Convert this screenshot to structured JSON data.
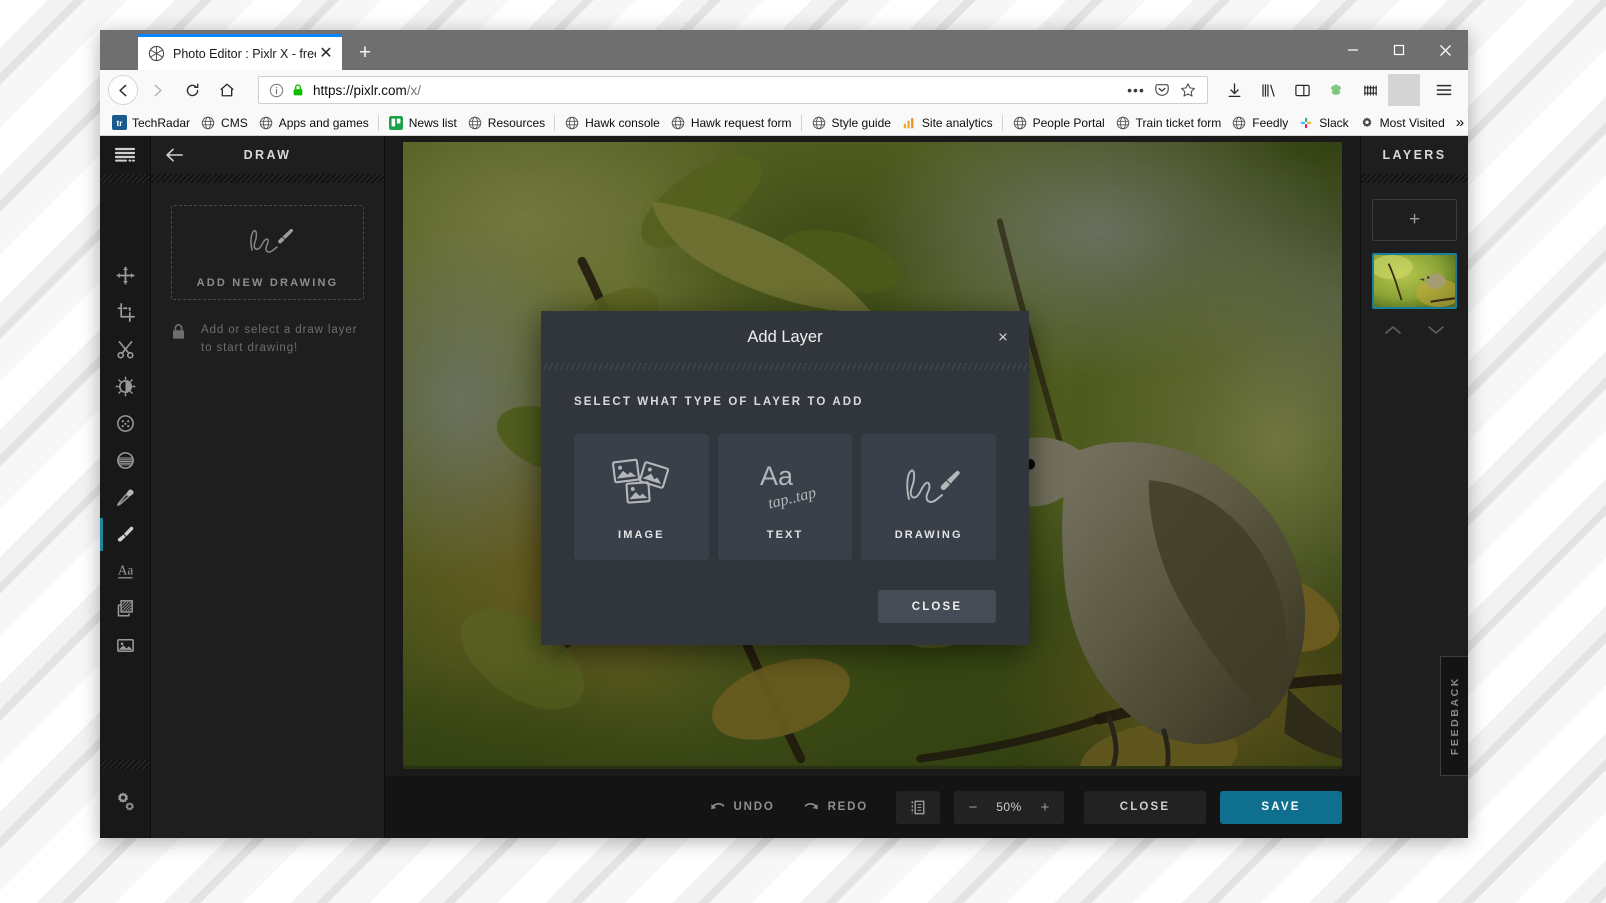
{
  "browser": {
    "tab": {
      "title": "Photo Editor : Pixlr X - free imag",
      "favicon": "pixlr-aperture-icon",
      "close_label": "✕"
    },
    "newtab_label": "+",
    "window_controls": {
      "minimize": "—",
      "maximize": "□",
      "close": "✕"
    },
    "nav": {
      "back": "←",
      "forward": "→",
      "reload": "↻",
      "home": "⌂"
    },
    "url": {
      "scheme_host": "https://pixlr.com",
      "path": "/x/",
      "info_icon": "info-icon",
      "lock_icon": "padlock-icon"
    },
    "urlbar_actions": {
      "page_actions": "•••",
      "pocket": "pocket-icon",
      "bookmark": "star-icon"
    },
    "toolbar_icons": [
      "downloads-icon",
      "library-icon",
      "sidebar-icon",
      "ublock-icon",
      "container-tabs-icon",
      "menu-icon"
    ],
    "bookmarks": [
      {
        "label": "TechRadar",
        "icon": "techradar-icon"
      },
      {
        "label": "CMS",
        "icon": "globe-icon"
      },
      {
        "label": "Apps and games",
        "icon": "globe-icon"
      },
      {
        "sep": true
      },
      {
        "label": "News list",
        "icon": "trello-icon"
      },
      {
        "label": "Resources",
        "icon": "globe-icon"
      },
      {
        "sep": true
      },
      {
        "label": "Hawk console",
        "icon": "globe-icon"
      },
      {
        "label": "Hawk request form",
        "icon": "globe-icon"
      },
      {
        "sep": true
      },
      {
        "label": "Style guide",
        "icon": "globe-icon"
      },
      {
        "label": "Site analytics",
        "icon": "analytics-icon"
      },
      {
        "sep": true
      },
      {
        "label": "People Portal",
        "icon": "globe-icon"
      },
      {
        "label": "Train ticket form",
        "icon": "globe-icon"
      },
      {
        "label": "Feedly",
        "icon": "globe-icon"
      },
      {
        "label": "Slack",
        "icon": "slack-icon"
      },
      {
        "label": "Most Visited",
        "icon": "gear-icon"
      }
    ],
    "bookmarks_overflow": "»"
  },
  "app": {
    "rail": {
      "menu_icon": "hamburger-menu-icon",
      "tools": [
        {
          "name": "arrange-tool",
          "icon": "move-arrows-icon",
          "active": false
        },
        {
          "name": "crop-tool",
          "icon": "crop-icon",
          "active": false
        },
        {
          "name": "cutout-tool",
          "icon": "scissors-icon",
          "active": false
        },
        {
          "name": "adjust-tool",
          "icon": "brightness-icon",
          "active": false
        },
        {
          "name": "effect-tool",
          "icon": "dots-circle-icon",
          "active": false
        },
        {
          "name": "retouch-tool",
          "icon": "halftone-circle-icon",
          "active": false
        },
        {
          "name": "liquify-tool",
          "icon": "dropper-icon",
          "active": false
        },
        {
          "name": "draw-tool",
          "icon": "paintbrush-icon",
          "active": true
        },
        {
          "name": "text-tool",
          "icon": "text-aa-icon",
          "active": false
        },
        {
          "name": "element-tool",
          "icon": "layers-stack-icon",
          "active": false
        },
        {
          "name": "add-image-tool",
          "icon": "picture-icon",
          "active": false
        }
      ],
      "settings_icon": "gears-icon"
    },
    "panel": {
      "back_icon": "arrow-left-icon",
      "title": "DRAW",
      "dropzone": {
        "icon": "drawing-squiggle-brush-icon",
        "label": "ADD NEW DRAWING"
      },
      "hint": {
        "icon": "padlock-icon",
        "text": "Add or select a draw layer to start drawing!"
      }
    },
    "bottombar": {
      "undo": {
        "label": "UNDO",
        "icon": "undo-arrow-icon"
      },
      "redo": {
        "label": "REDO",
        "icon": "redo-arrow-icon"
      },
      "fit_icon": "fit-to-screen-icon",
      "zoom": {
        "minus": "−",
        "value": "50%",
        "plus": "+"
      },
      "close_label": "CLOSE",
      "save_label": "SAVE"
    },
    "layers": {
      "title": "LAYERS",
      "add_label": "+",
      "thumbnail_name": "background-layer-thumbnail",
      "move_up_icon": "chevron-up-icon",
      "move_down_icon": "chevron-down-icon"
    },
    "feedback_label": "FEEDBACK"
  },
  "modal": {
    "title": "Add Layer",
    "close_icon": "×",
    "subtitle": "SELECT WHAT TYPE OF LAYER TO ADD",
    "cards": [
      {
        "label": "IMAGE",
        "icon": "stacked-photos-icon"
      },
      {
        "label": "TEXT",
        "icon": "text-aa-tap-icon"
      },
      {
        "label": "DRAWING",
        "icon": "squiggle-brush-icon"
      }
    ],
    "close_button": "CLOSE"
  },
  "colors": {
    "accent": "#0f6f8e",
    "layer_selected_border": "#1b7e9c",
    "modal_bg": "#31363d",
    "card_bg": "#3a4049",
    "tab_accent": "#0a84ff"
  }
}
